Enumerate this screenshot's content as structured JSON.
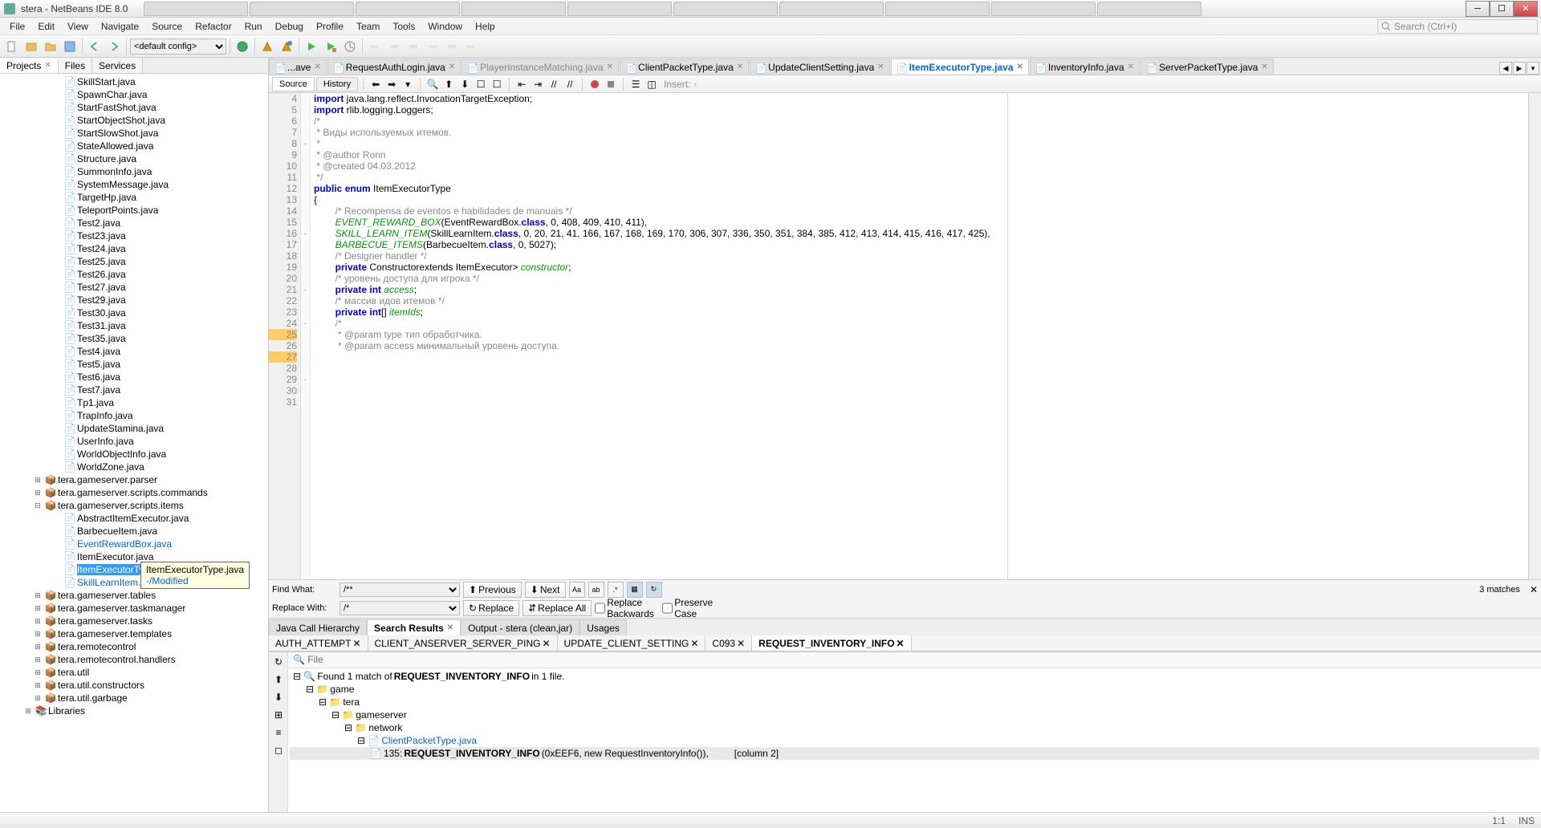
{
  "window": {
    "title": "stera - NetBeans IDE 8.0"
  },
  "menus": [
    "File",
    "Edit",
    "View",
    "Navigate",
    "Source",
    "Refactor",
    "Run",
    "Debug",
    "Profile",
    "Team",
    "Tools",
    "Window",
    "Help"
  ],
  "search_placeholder": "Search (Ctrl+I)",
  "config_dropdown": "<default config>",
  "left_tabs": [
    {
      "label": "Projects",
      "active": true,
      "closable": true
    },
    {
      "label": "Files",
      "active": false
    },
    {
      "label": "Services",
      "active": false
    }
  ],
  "tree_files": [
    "SkillStart.java",
    "SpawnChar.java",
    "StartFastShot.java",
    "StartObjectShot.java",
    "StartSlowShot.java",
    "StateAllowed.java",
    "Structure.java",
    "SummonInfo.java",
    "SystemMessage.java",
    "TargetHp.java",
    "TeleportPoints.java",
    "Test2.java",
    "Test23.java",
    "Test24.java",
    "Test25.java",
    "Test26.java",
    "Test27.java",
    "Test29.java",
    "Test30.java",
    "Test31.java",
    "Test35.java",
    "Test4.java",
    "Test5.java",
    "Test6.java",
    "Test7.java",
    "Tp1.java",
    "TrapInfo.java",
    "UpdateStamina.java",
    "UserInfo.java",
    "WorldObjectInfo.java",
    "WorldZone.java"
  ],
  "tree_packages": [
    {
      "label": "tera.gameserver.parser",
      "items": []
    },
    {
      "label": "tera.gameserver.scripts.commands",
      "items": []
    },
    {
      "label": "tera.gameserver.scripts.items",
      "expanded": true,
      "items": [
        "AbstractItemExecutor.java",
        "BarbecueItem.java",
        {
          "label": "EventRewardBox.java",
          "blue": true
        },
        "ItemExecutor.java",
        {
          "label": "ItemExecutorType.java",
          "selected": true
        },
        {
          "label": "SkillLearnItem.java",
          "blue": true
        }
      ]
    },
    {
      "label": "tera.gameserver.tables"
    },
    {
      "label": "tera.gameserver.taskmanager"
    },
    {
      "label": "tera.gameserver.tasks"
    },
    {
      "label": "tera.gameserver.templates"
    },
    {
      "label": "tera.remotecontrol"
    },
    {
      "label": "tera.remotecontrol.handlers"
    },
    {
      "label": "tera.util"
    },
    {
      "label": "tera.util.constructors"
    },
    {
      "label": "tera.util.garbage"
    }
  ],
  "tree_libraries": "Libraries",
  "tooltip": {
    "line1": "ItemExecutorType.java",
    "line2": "-/Modified"
  },
  "editor_tabs": [
    {
      "label": "...ave",
      "active": false,
      "closable": true
    },
    {
      "label": "RequestAuthLogin.java",
      "active": false,
      "closable": true
    },
    {
      "label": "PlayerInstanceMatching.java",
      "active": false,
      "closable": true,
      "color": "#888"
    },
    {
      "label": "ClientPacketType.java",
      "active": false,
      "closable": true
    },
    {
      "label": "UpdateClientSetting.java",
      "active": false,
      "closable": true
    },
    {
      "label": "ItemExecutorType.java",
      "active": true,
      "closable": true
    },
    {
      "label": "InventoryInfo.java",
      "active": false,
      "closable": true
    },
    {
      "label": "ServerPacketType.java",
      "active": false,
      "closable": true
    }
  ],
  "sub_tabs": [
    {
      "label": "Source",
      "active": true
    },
    {
      "label": "History",
      "active": false
    }
  ],
  "breadcrumb_insert": "Insert:",
  "code_lines": [
    {
      "n": 4,
      "t": "import java.lang.reflect.InvocationTargetException;",
      "kw": [
        "import"
      ]
    },
    {
      "n": 5,
      "t": ""
    },
    {
      "n": 6,
      "t": "import rlib.logging.Loggers;",
      "kw": [
        "import"
      ]
    },
    {
      "n": 7,
      "t": ""
    },
    {
      "n": 8,
      "t": "/*",
      "cm": true,
      "fold": "-"
    },
    {
      "n": 9,
      "t": " * Виды используемых итемов.",
      "cm": true
    },
    {
      "n": 10,
      "t": " *",
      "cm": true
    },
    {
      "n": 11,
      "t": " * @author Ronn",
      "cm": true
    },
    {
      "n": 12,
      "t": " * @created 04.03.2012",
      "cm": true
    },
    {
      "n": 13,
      "t": " */",
      "cm": true
    },
    {
      "n": 14,
      "t": "public enum ItemExecutorType",
      "kw": [
        "public",
        "enum"
      ]
    },
    {
      "n": 15,
      "t": "{"
    },
    {
      "n": 16,
      "t": "        /* Recompensa de eventos e habilidades de manuais */",
      "cm": true,
      "fold": "-"
    },
    {
      "n": 17,
      "t": "        EVENT_REWARD_BOX(EventRewardBox.class, 0, 408, 409, 410, 411),",
      "fld": [
        "EVENT_REWARD_BOX"
      ],
      "kw": [
        "class"
      ]
    },
    {
      "n": 18,
      "t": "        SKILL_LEARN_ITEM(SkillLearnItem.class, 0, 20, 21, 41, 166, 167, 168, 169, 170, 306, 307, 336, 350, 351, 384, 385, 412, 413, 414, 415, 416, 417, 425),",
      "fld": [
        "SKILL_LEARN_ITEM"
      ],
      "kw": [
        "class"
      ]
    },
    {
      "n": 19,
      "t": "        BARBECUE_ITEMS(BarbecueItem.class, 0, 5027);",
      "fld": [
        "BARBECUE_ITEMS"
      ],
      "kw": [
        "class"
      ]
    },
    {
      "n": 20,
      "t": ""
    },
    {
      "n": 21,
      "t": "        /* Designer handler */",
      "cm": true,
      "fold": "-"
    },
    {
      "n": 22,
      "t": "        private Constructor<? extends ItemExecutor> constructor;",
      "kw": [
        "private",
        "extends"
      ],
      "fld": [
        "constructor"
      ]
    },
    {
      "n": 23,
      "t": ""
    },
    {
      "n": 24,
      "t": "        /* уровень доступа для игрока */",
      "cm": true,
      "fold": "-"
    },
    {
      "n": 25,
      "t": "        private int access;",
      "kw": [
        "private",
        "int"
      ],
      "fld": [
        "access"
      ],
      "warn": true
    },
    {
      "n": 26,
      "t": "        /* массив идов итемов */",
      "cm": true
    },
    {
      "n": 27,
      "t": "        private int[] itemIds;",
      "kw": [
        "private",
        "int"
      ],
      "fld": [
        "itemIds"
      ],
      "warn": true
    },
    {
      "n": 28,
      "t": ""
    },
    {
      "n": 29,
      "t": "        /*",
      "cm": true,
      "fold": "-"
    },
    {
      "n": 30,
      "t": "         * @param type тип обработчика.",
      "cm": true
    },
    {
      "n": 31,
      "t": "         * @param access минимальный уровень доступа.",
      "cm": true
    }
  ],
  "find": {
    "find_label": "Find What:",
    "find_value": "/**",
    "replace_label": "Replace With:",
    "replace_value": "/*",
    "prev": "Previous",
    "next": "Next",
    "replace": "Replace",
    "replace_all": "Replace All",
    "replace_back": "Replace Backwards",
    "preserve": "Preserve Case",
    "matches": "3 matches"
  },
  "bottom_tabs": [
    {
      "label": "Java Call Hierarchy"
    },
    {
      "label": "Search Results",
      "closable": true,
      "active": true
    },
    {
      "label": "Output - stera (clean,jar)"
    },
    {
      "label": "Usages"
    }
  ],
  "search_sub_tabs": [
    {
      "label": "AUTH_ATTEMPT",
      "closable": true
    },
    {
      "label": "CLIENT_ANSERVER_SERVER_PING",
      "closable": true
    },
    {
      "label": "UPDATE_CLIENT_SETTING",
      "closable": true
    },
    {
      "label": "C093",
      "closable": true
    },
    {
      "label": "REQUEST_INVENTORY_INFO",
      "closable": true,
      "active": true
    }
  ],
  "results": {
    "header": "File",
    "summary_pre": "Found 1 match of ",
    "summary_bold": "REQUEST_INVENTORY_INFO",
    "summary_post": " in 1 file.",
    "path": [
      "game",
      "tera",
      "gameserver",
      "network",
      "ClientPacketType.java"
    ],
    "hit_line": "135: ",
    "hit_bold": "REQUEST_INVENTORY_INFO",
    "hit_post": "(0xEEF6, new RequestInventoryInfo()),",
    "hit_col": "[column 2]"
  },
  "status": {
    "pos": "1:1",
    "mode": "INS"
  }
}
